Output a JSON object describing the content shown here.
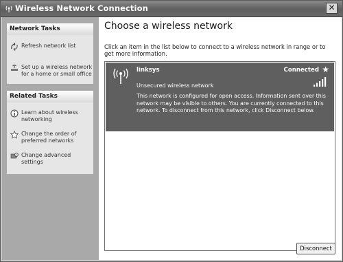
{
  "window": {
    "title": "Wireless Network Connection",
    "close_glyph": "✕",
    "icon": "wireless-network-icon"
  },
  "network_tasks": {
    "heading": "Network Tasks",
    "items": [
      {
        "label": "Refresh network list",
        "icon": "refresh-icon"
      },
      {
        "label": "Set up a wireless network for a home or small office",
        "icon": "setup-wireless-icon"
      }
    ]
  },
  "related_tasks": {
    "heading": "Related Tasks",
    "items": [
      {
        "label": "Learn about wireless networking",
        "icon": "info-icon"
      },
      {
        "label": "Change the order of preferred networks",
        "icon": "star-outline-icon"
      },
      {
        "label": "Change advanced settings",
        "icon": "settings-icon"
      }
    ]
  },
  "main": {
    "title": "Choose a wireless network",
    "description": "Click an item in the list below to connect to a wireless network in range or to get more information."
  },
  "networks": [
    {
      "name": "linksys",
      "status": "Connected",
      "security": "Unsecured wireless network",
      "info": "This network is configured for open access. Information sent over this network may be visible to others. You are currently connected to this network. To disconnect from this network, click Disconnect below.",
      "signal_strength_bars": 5,
      "icons": [
        "wireless-signal-icon",
        "star-icon",
        "signal-strength-icon"
      ]
    }
  ],
  "buttons": {
    "disconnect": "Disconnect"
  },
  "colors": {
    "selected_row": "#5f5f5f",
    "task_pane": "#a9a9a9",
    "title_bar": "#6b6b6b"
  }
}
